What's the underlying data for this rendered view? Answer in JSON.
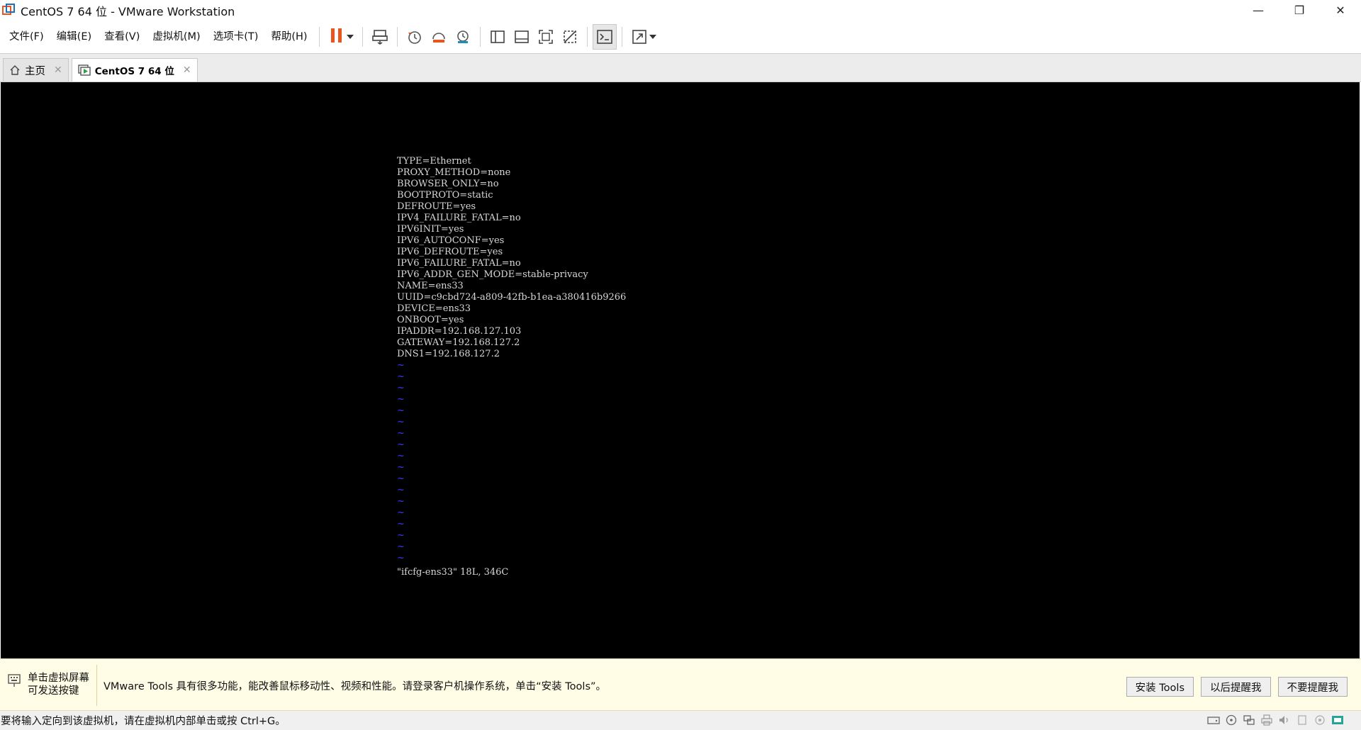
{
  "window": {
    "title": "CentOS 7 64 位 - VMware Workstation",
    "minimize_glyph": "—",
    "restore_glyph": "❐",
    "close_glyph": "✕"
  },
  "menu": {
    "items": [
      "文件(F)",
      "编辑(E)",
      "查看(V)",
      "虚拟机(M)",
      "选项卡(T)",
      "帮助(H)"
    ]
  },
  "toolbar": {
    "icons": [
      "pause-icon",
      "send-ctrl-alt-del-icon",
      "snapshot-icon",
      "revert-snapshot-icon",
      "snapshot-manager-icon",
      "show-library-icon",
      "thumbnail-bar-icon",
      "full-screen-icon",
      "unity-icon",
      "console-view-icon",
      "stretch-guest-icon"
    ],
    "accent_color": "#e8561f"
  },
  "tabs": [
    {
      "label": "主页",
      "close": "✕"
    },
    {
      "label": "CentOS 7 64 位",
      "close": "✕"
    }
  ],
  "console": {
    "lines": [
      "TYPE=Ethernet",
      "PROXY_METHOD=none",
      "BROWSER_ONLY=no",
      "BOOTPROTO=static",
      "DEFROUTE=yes",
      "IPV4_FAILURE_FATAL=no",
      "IPV6INIT=yes",
      "IPV6_AUTOCONF=yes",
      "IPV6_DEFROUTE=yes",
      "IPV6_FAILURE_FATAL=no",
      "IPV6_ADDR_GEN_MODE=stable-privacy",
      "NAME=ens33",
      "UUID=c9cbd724-a809-42fb-b1ea-a380416b9266",
      "DEVICE=ens33",
      "ONBOOT=yes",
      "IPADDR=192.168.127.103",
      "GATEWAY=192.168.127.2",
      "DNS1=192.168.127.2"
    ],
    "tilde": "~",
    "tilde_count": 18,
    "status_line": "\"ifcfg-ens33\" 18L, 346C",
    "tilde_color": "#3b3bff"
  },
  "notification": {
    "hint_line1": "单击虚拟屏幕",
    "hint_line2": "可发送按键",
    "message": "VMware Tools 具有很多功能，能改善鼠标移动性、视频和性能。请登录客户机操作系统，单击“安装 Tools”。",
    "buttons": [
      "安装 Tools",
      "以后提醒我",
      "不要提醒我"
    ]
  },
  "statusbar": {
    "text": "要将输入定向到该虚拟机，请在虚拟机内部单击或按 Ctrl+G。",
    "icons": [
      "hard-disk-icon",
      "cd-dvd-icon",
      "network-icon",
      "printer-icon",
      "sound-icon",
      "usb-icon",
      "display-icon",
      "vm-status-icon"
    ]
  }
}
